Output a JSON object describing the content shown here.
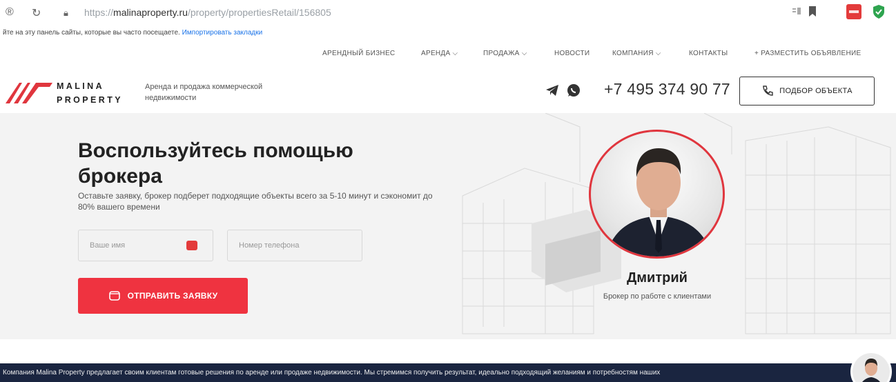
{
  "browser": {
    "url_prefix": "https://",
    "url_domain": "malinaproperty.ru",
    "url_path": "/property/propertiesRetail/156805",
    "bookmarks_hint": "йте на эту панель сайты, которые вы часто посещаете.",
    "bookmarks_link": "Импортировать закладки"
  },
  "topnav": {
    "items": [
      "АРЕНДНЫЙ БИЗНЕС",
      "АРЕНДА ⌵",
      "ПРОДАЖА ⌵",
      "НОВОСТИ",
      "КОМПАНИЯ ⌵",
      "КОНТАКТЫ",
      "+ РАЗМЕСТИТЬ ОБЪЯВЛЕНИЕ"
    ]
  },
  "header": {
    "brand_line1": "MALINA",
    "brand_line2": "PROPERTY",
    "tagline": "Аренда и продажа коммерческой недвижимости",
    "phone": "+7 495 374 90 77",
    "pick_button": "ПОДБОР ОБЪЕКТА"
  },
  "hero": {
    "title": "Воспользуйтесь помощью брокера",
    "subtitle": "Оставьте заявку, брокер подберет подходящие объекты всего за 5-10 минут и сэкономит до 80% вашего времени",
    "name_placeholder": "Ваше имя",
    "phone_placeholder": "Номер телефона",
    "submit_label": "ОТПРАВИТЬ ЗАЯВКУ"
  },
  "broker": {
    "name": "Дмитрий",
    "role": "Брокер по работе с клиентами"
  },
  "footer_strip": {
    "text": "Компания Malina Property предлагает своим клиентам готовые решения по аренде или продаже недвижимости. Мы стремимся получить результат, идеально подходящий желаниям и потребностям наших"
  },
  "colors": {
    "accent": "#ef3340",
    "dark": "#1a2540"
  }
}
